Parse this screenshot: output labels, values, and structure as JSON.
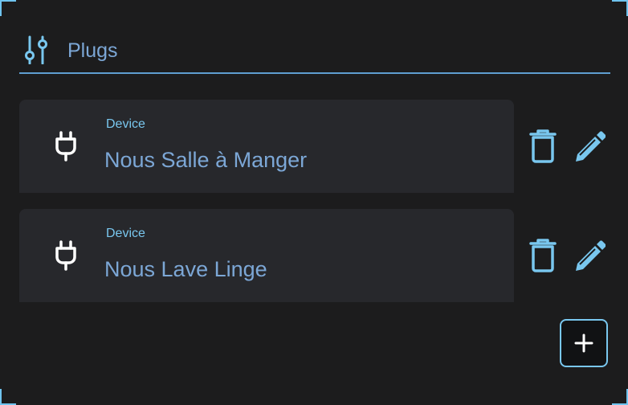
{
  "header": {
    "title": "Plugs",
    "icon": "tune-sliders-icon"
  },
  "plugs": [
    {
      "caption": "Device",
      "name": "Nous Salle à Manger",
      "icon": "power-plug-icon"
    },
    {
      "caption": "Device",
      "name": "Nous Lave Linge",
      "icon": "power-plug-icon"
    }
  ],
  "actions": {
    "delete_icon": "trash-icon",
    "edit_icon": "pencil-icon",
    "add_icon": "plus-icon"
  },
  "colors": {
    "accent": "#79c7ef",
    "text_accent": "#7ca7d6",
    "background": "#1c1c1d",
    "card": "#27282c"
  }
}
